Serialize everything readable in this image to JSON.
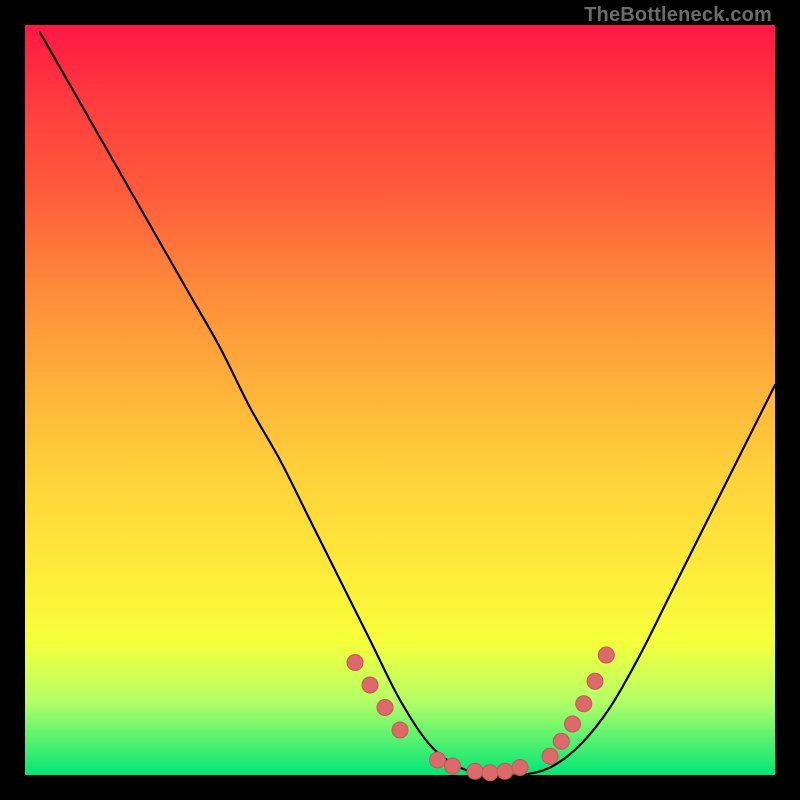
{
  "attribution": "TheBottleneck.com",
  "colors": {
    "curve": "#000000",
    "marker_fill": "#dd6a6a",
    "marker_stroke": "#c95555"
  },
  "chart_data": {
    "type": "line",
    "title": "",
    "xlabel": "",
    "ylabel": "",
    "xlim": [
      0,
      100
    ],
    "ylim": [
      0,
      100
    ],
    "series": [
      {
        "name": "bottleneck-curve",
        "x": [
          2,
          6,
          10,
          14,
          18,
          22,
          26,
          30,
          34,
          38,
          42,
          46,
          50,
          54,
          58,
          62,
          66,
          70,
          74,
          78,
          82,
          86,
          90,
          94,
          98,
          100
        ],
        "y": [
          99,
          92,
          85,
          78,
          71,
          64,
          57,
          49,
          42,
          34,
          26,
          18,
          10,
          4,
          1,
          0,
          0,
          1,
          4,
          9,
          16,
          24,
          32,
          40,
          48,
          52
        ]
      }
    ],
    "markers": {
      "name": "highlight-points",
      "x": [
        44,
        46,
        48,
        50,
        55,
        57,
        60,
        62,
        64,
        66,
        70,
        71.5,
        73,
        74.5,
        76,
        77.5
      ],
      "y": [
        15,
        12,
        9,
        6,
        2,
        1.2,
        0.5,
        0.3,
        0.5,
        1.0,
        2.5,
        4.5,
        6.8,
        9.5,
        12.5,
        16
      ]
    }
  }
}
